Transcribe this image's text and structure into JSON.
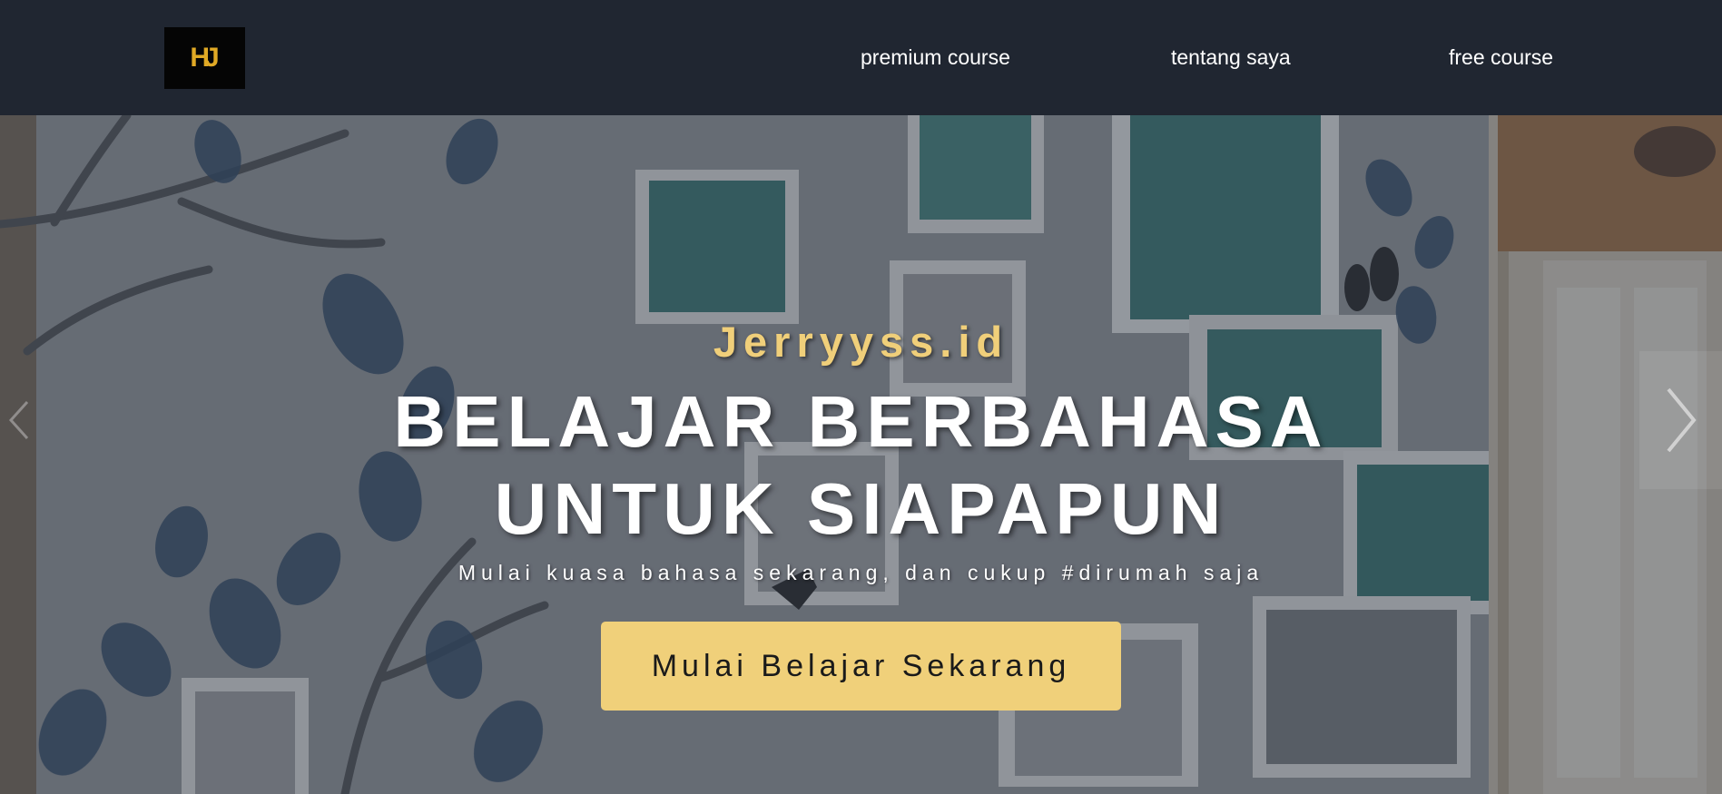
{
  "navbar": {
    "logo_text": "HJ",
    "links": [
      {
        "label": "premium course"
      },
      {
        "label": "tentang saya"
      },
      {
        "label": "free course"
      }
    ]
  },
  "hero": {
    "brand": "Jerryyss.id",
    "headline_line1": "BELAJAR BERBAHASA",
    "headline_line2": "UNTUK SIAPAPUN",
    "tagline": "Mulai kuasa bahasa sekarang, dan cukup #dirumah saja",
    "cta_label": "Mulai Belajar Sekarang",
    "next_icon": "chevron-right-icon",
    "prev_icon": "chevron-left-icon"
  },
  "colors": {
    "navbar_bg": "#202631",
    "brand_gold": "#f0cf7a",
    "logo_gold": "#e0a925",
    "cta_bg": "#f0d07a",
    "text_white": "#ffffff"
  }
}
